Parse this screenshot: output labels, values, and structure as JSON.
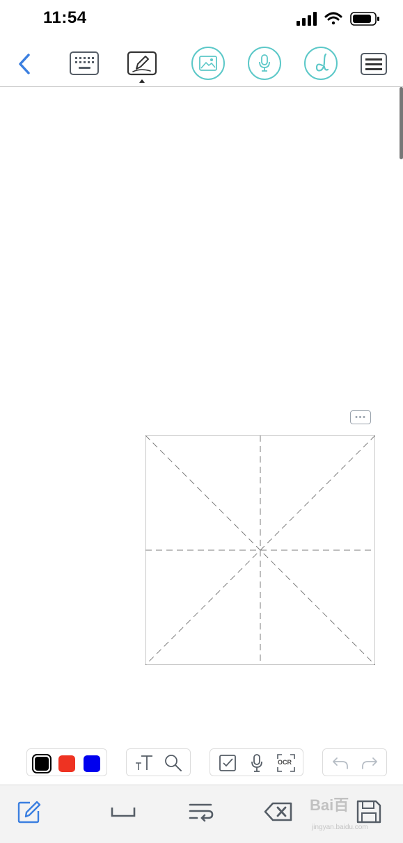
{
  "status_bar": {
    "time": "11:54"
  },
  "toolbar": {
    "back": "back-icon",
    "keyboard": "keyboard-icon",
    "handwrite": "pen-icon",
    "image": "image-icon",
    "voice": "mic-icon",
    "doodle": "doodle-icon",
    "menu": "menu-icon"
  },
  "tools": {
    "colors": [
      "#000000",
      "#ee3322",
      "#0000ee"
    ],
    "selected_color": "#000000",
    "ocr_label": "OCR"
  },
  "watermark": {
    "text": "Bai百",
    "sub": "jingyan.baidu.com"
  },
  "accent": "#5cc8c8",
  "back_color": "#3b7fe0"
}
